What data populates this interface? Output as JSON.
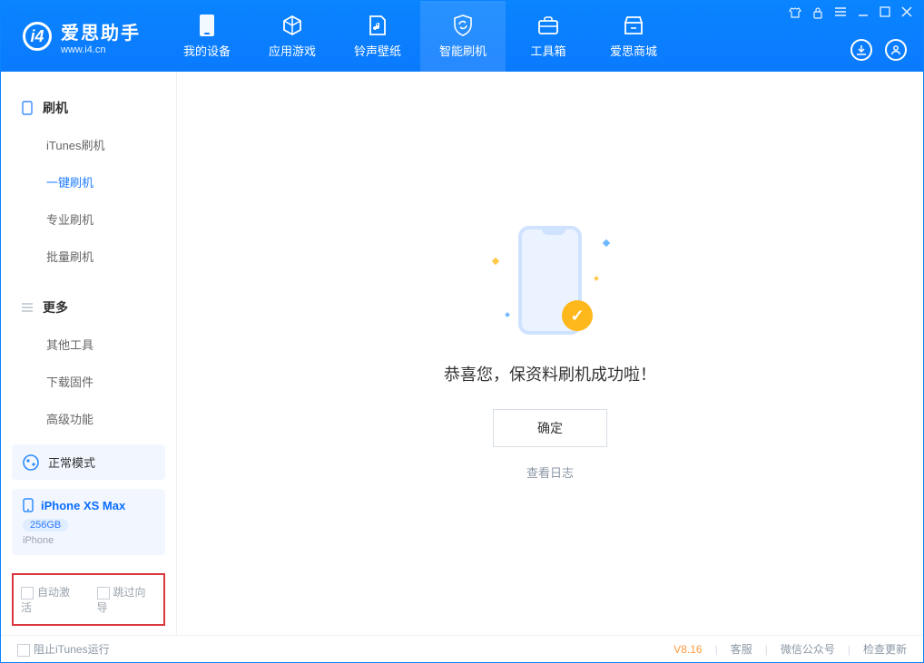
{
  "app": {
    "title": "爱思助手",
    "subtitle": "www.i4.cn"
  },
  "topnav": {
    "items": [
      {
        "label": "我的设备"
      },
      {
        "label": "应用游戏"
      },
      {
        "label": "铃声壁纸"
      },
      {
        "label": "智能刷机"
      },
      {
        "label": "工具箱"
      },
      {
        "label": "爱思商城"
      }
    ]
  },
  "sidebar": {
    "flash_header": "刷机",
    "more_header": "更多",
    "flash_items": [
      {
        "label": "iTunes刷机"
      },
      {
        "label": "一键刷机"
      },
      {
        "label": "专业刷机"
      },
      {
        "label": "批量刷机"
      }
    ],
    "more_items": [
      {
        "label": "其他工具"
      },
      {
        "label": "下载固件"
      },
      {
        "label": "高级功能"
      }
    ],
    "mode_label": "正常模式",
    "device_name": "iPhone XS Max",
    "device_storage": "256GB",
    "device_type": "iPhone",
    "auto_activate": "自动激活",
    "skip_guide": "跳过向导"
  },
  "main": {
    "success_message": "恭喜您，保资料刷机成功啦！",
    "confirm_label": "确定",
    "view_log_label": "查看日志"
  },
  "footer": {
    "block_itunes": "阻止iTunes运行",
    "version": "V8.16",
    "links": [
      {
        "label": "客服"
      },
      {
        "label": "微信公众号"
      },
      {
        "label": "检查更新"
      }
    ]
  }
}
